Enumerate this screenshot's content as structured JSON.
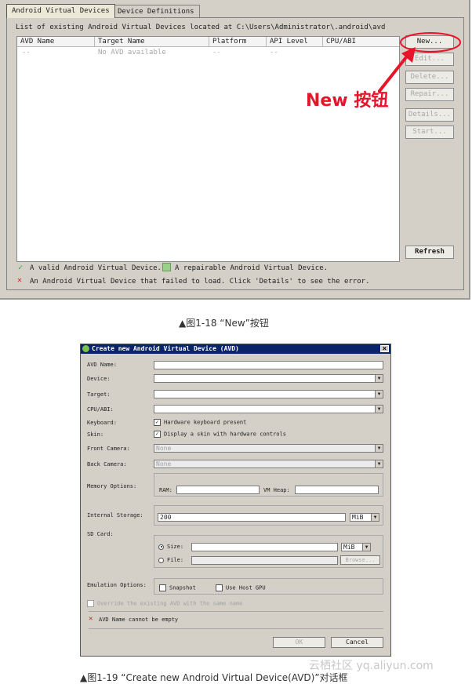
{
  "figure1": {
    "tabs": [
      {
        "label": "Android Virtual Devices",
        "active": true
      },
      {
        "label": "Device Definitions",
        "active": false
      }
    ],
    "list_caption": "List of existing Android Virtual Devices located at C:\\Users\\Administrator\\.android\\avd",
    "table": {
      "columns": [
        "AVD Name",
        "Target Name",
        "Platform",
        "API Level",
        "CPU/ABI"
      ],
      "rows": [
        [
          "--",
          "No AVD available",
          "--",
          "--",
          ""
        ]
      ]
    },
    "buttons": {
      "new": "New...",
      "edit": "Edit...",
      "delete": "Delete...",
      "repair": "Repair...",
      "details": "Details...",
      "start": "Start...",
      "refresh": "Refresh"
    },
    "legend": {
      "valid": "A valid Android Virtual Device.",
      "repairable": "A repairable Android Virtual Device.",
      "failed": "An Android Virtual Device that failed to load. Click 'Details' to see the error."
    },
    "annotation": "New 按钮",
    "caption": "▲图1-18 “New”按钮"
  },
  "figure2": {
    "title": "Create new Android Virtual Device (AVD)",
    "close_glyph": "×",
    "labels": {
      "avd_name": "AVD Name:",
      "device": "Device:",
      "target": "Target:",
      "cpu_abi": "CPU/ABI:",
      "keyboard": "Keyboard:",
      "skin": "Skin:",
      "front_camera": "Front Camera:",
      "back_camera": "Back Camera:",
      "memory_options": "Memory Options:",
      "ram": "RAM:",
      "vm_heap": "VM Heap:",
      "internal_storage": "Internal Storage:",
      "sd_card": "SD Card:",
      "size": "Size:",
      "file": "File:",
      "emulation_options": "Emulation Options:"
    },
    "keyboard_checkbox": "Hardware keyboard present",
    "skin_checkbox": "Display a skin with hardware controls",
    "front_camera_value": "None",
    "back_camera_value": "None",
    "internal_storage_value": "200",
    "internal_storage_unit": "MiB",
    "sd_size_unit": "MiB",
    "browse": "Browse...",
    "snapshot": "Snapshot",
    "use_host_gpu": "Use Host GPU",
    "override": "Override the existing AVD with the same name",
    "error_message": "AVD Name cannot be empty",
    "ok": "OK",
    "cancel": "Cancel",
    "caption": "▲图1-19 “Create new Android Virtual Device(AVD)”对话框"
  },
  "watermark": "云栖社区 yq.aliyun.com",
  "colors": {
    "annotation_red": "#e8142a",
    "titlebar_blue": "#0a246a",
    "valid_green": "#2aa52a",
    "error_red": "#d42020"
  }
}
